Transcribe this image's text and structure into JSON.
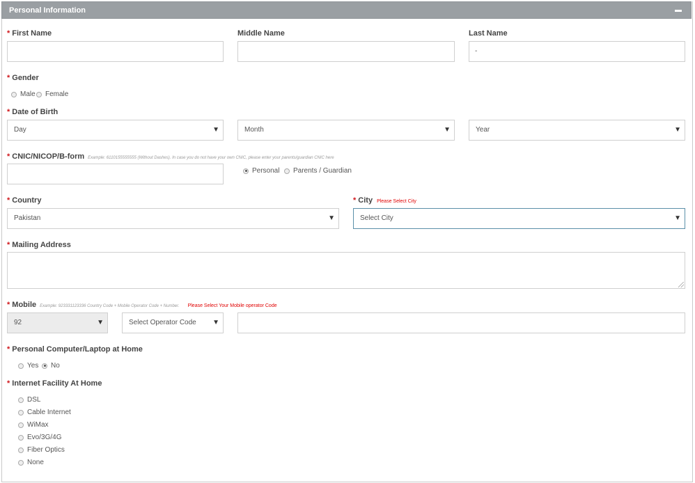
{
  "panel": {
    "title": "Personal Information"
  },
  "required_mark": "*",
  "first_name": {
    "label": "First Name",
    "value": ""
  },
  "middle_name": {
    "label": "Middle Name",
    "value": ""
  },
  "last_name": {
    "label": "Last Name",
    "value": "-"
  },
  "gender": {
    "label": "Gender",
    "options": [
      "Male",
      "Female"
    ]
  },
  "dob": {
    "label": "Date of Birth",
    "day": "Day",
    "month": "Month",
    "year": "Year"
  },
  "cnic": {
    "label": "CNIC/NICOP/B-form",
    "hint": "Example: 6110155555555 (Without Dashes). In case you do not have your own CNIC, please enter your parents/guardian CNIC here",
    "options": [
      "Personal",
      "Parents / Guardian"
    ]
  },
  "country": {
    "label": "Country",
    "value": "Pakistan"
  },
  "city": {
    "label": "City",
    "error": "Please Select City",
    "value": "Select City"
  },
  "mailing_address": {
    "label": "Mailing Address"
  },
  "mobile": {
    "label": "Mobile",
    "hint": "Example: 923331123336 Country Code + Mobile Operator Code + Number.",
    "error": "Please Select Your Mobile operator Code",
    "country_code": "92",
    "operator": "Select Operator Code",
    "number": ""
  },
  "computer": {
    "label": "Personal Computer/Laptop at Home",
    "options": [
      "Yes",
      "No"
    ],
    "selected": "No"
  },
  "internet": {
    "label": "Internet Facility At Home",
    "options": [
      "DSL",
      "Cable Internet",
      "WiMax",
      "Evo/3G/4G",
      "Fiber Optics",
      "None"
    ]
  },
  "caret": "▼"
}
